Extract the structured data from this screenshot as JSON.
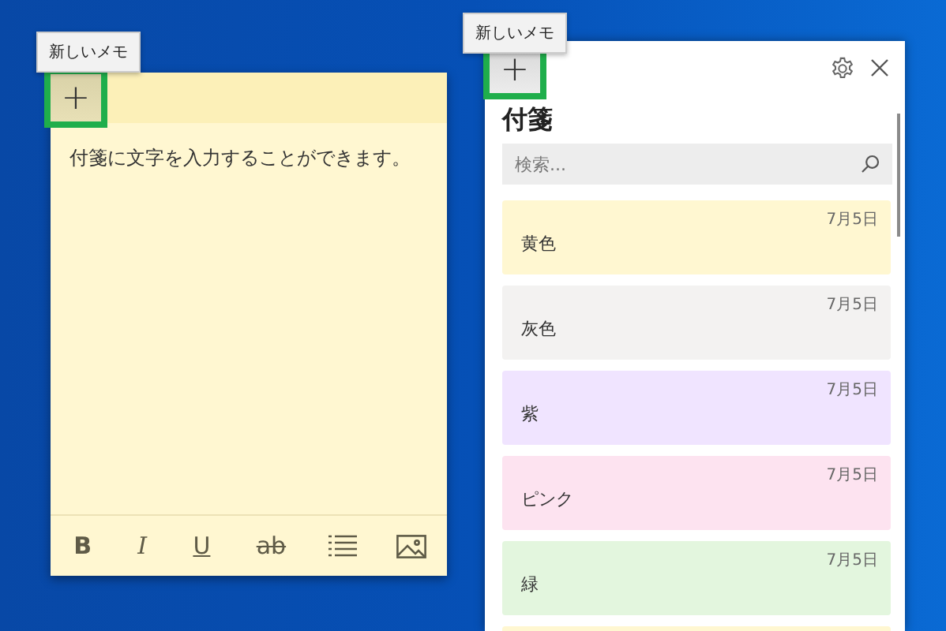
{
  "note": {
    "tooltip": "新しいメモ",
    "new_button": {
      "label": "+",
      "highlighted": true
    },
    "text": "付箋に文字を入力することができます。",
    "toolbar": [
      {
        "kind": "bold",
        "label": "B"
      },
      {
        "kind": "italic",
        "label": "I"
      },
      {
        "kind": "underline",
        "label": "U"
      },
      {
        "kind": "strike",
        "label": "ab"
      },
      {
        "kind": "list"
      },
      {
        "kind": "image"
      }
    ]
  },
  "panel": {
    "tooltip": "新しいメモ",
    "new_button": {
      "label": "+",
      "highlighted": true
    },
    "title": "付箋",
    "search": {
      "placeholder": "検索..."
    },
    "notes": [
      {
        "title": "黄色",
        "date": "7月5日",
        "color": "#fff7d1"
      },
      {
        "title": "灰色",
        "date": "7月5日",
        "color": "#f3f2f1"
      },
      {
        "title": "紫",
        "date": "7月5日",
        "color": "#f0e4ff"
      },
      {
        "title": "ピンク",
        "date": "7月5日",
        "color": "#fde3f0"
      },
      {
        "title": "緑",
        "date": "7月5日",
        "color": "#e3f6de"
      },
      {
        "color": "#fff7d1"
      }
    ]
  }
}
